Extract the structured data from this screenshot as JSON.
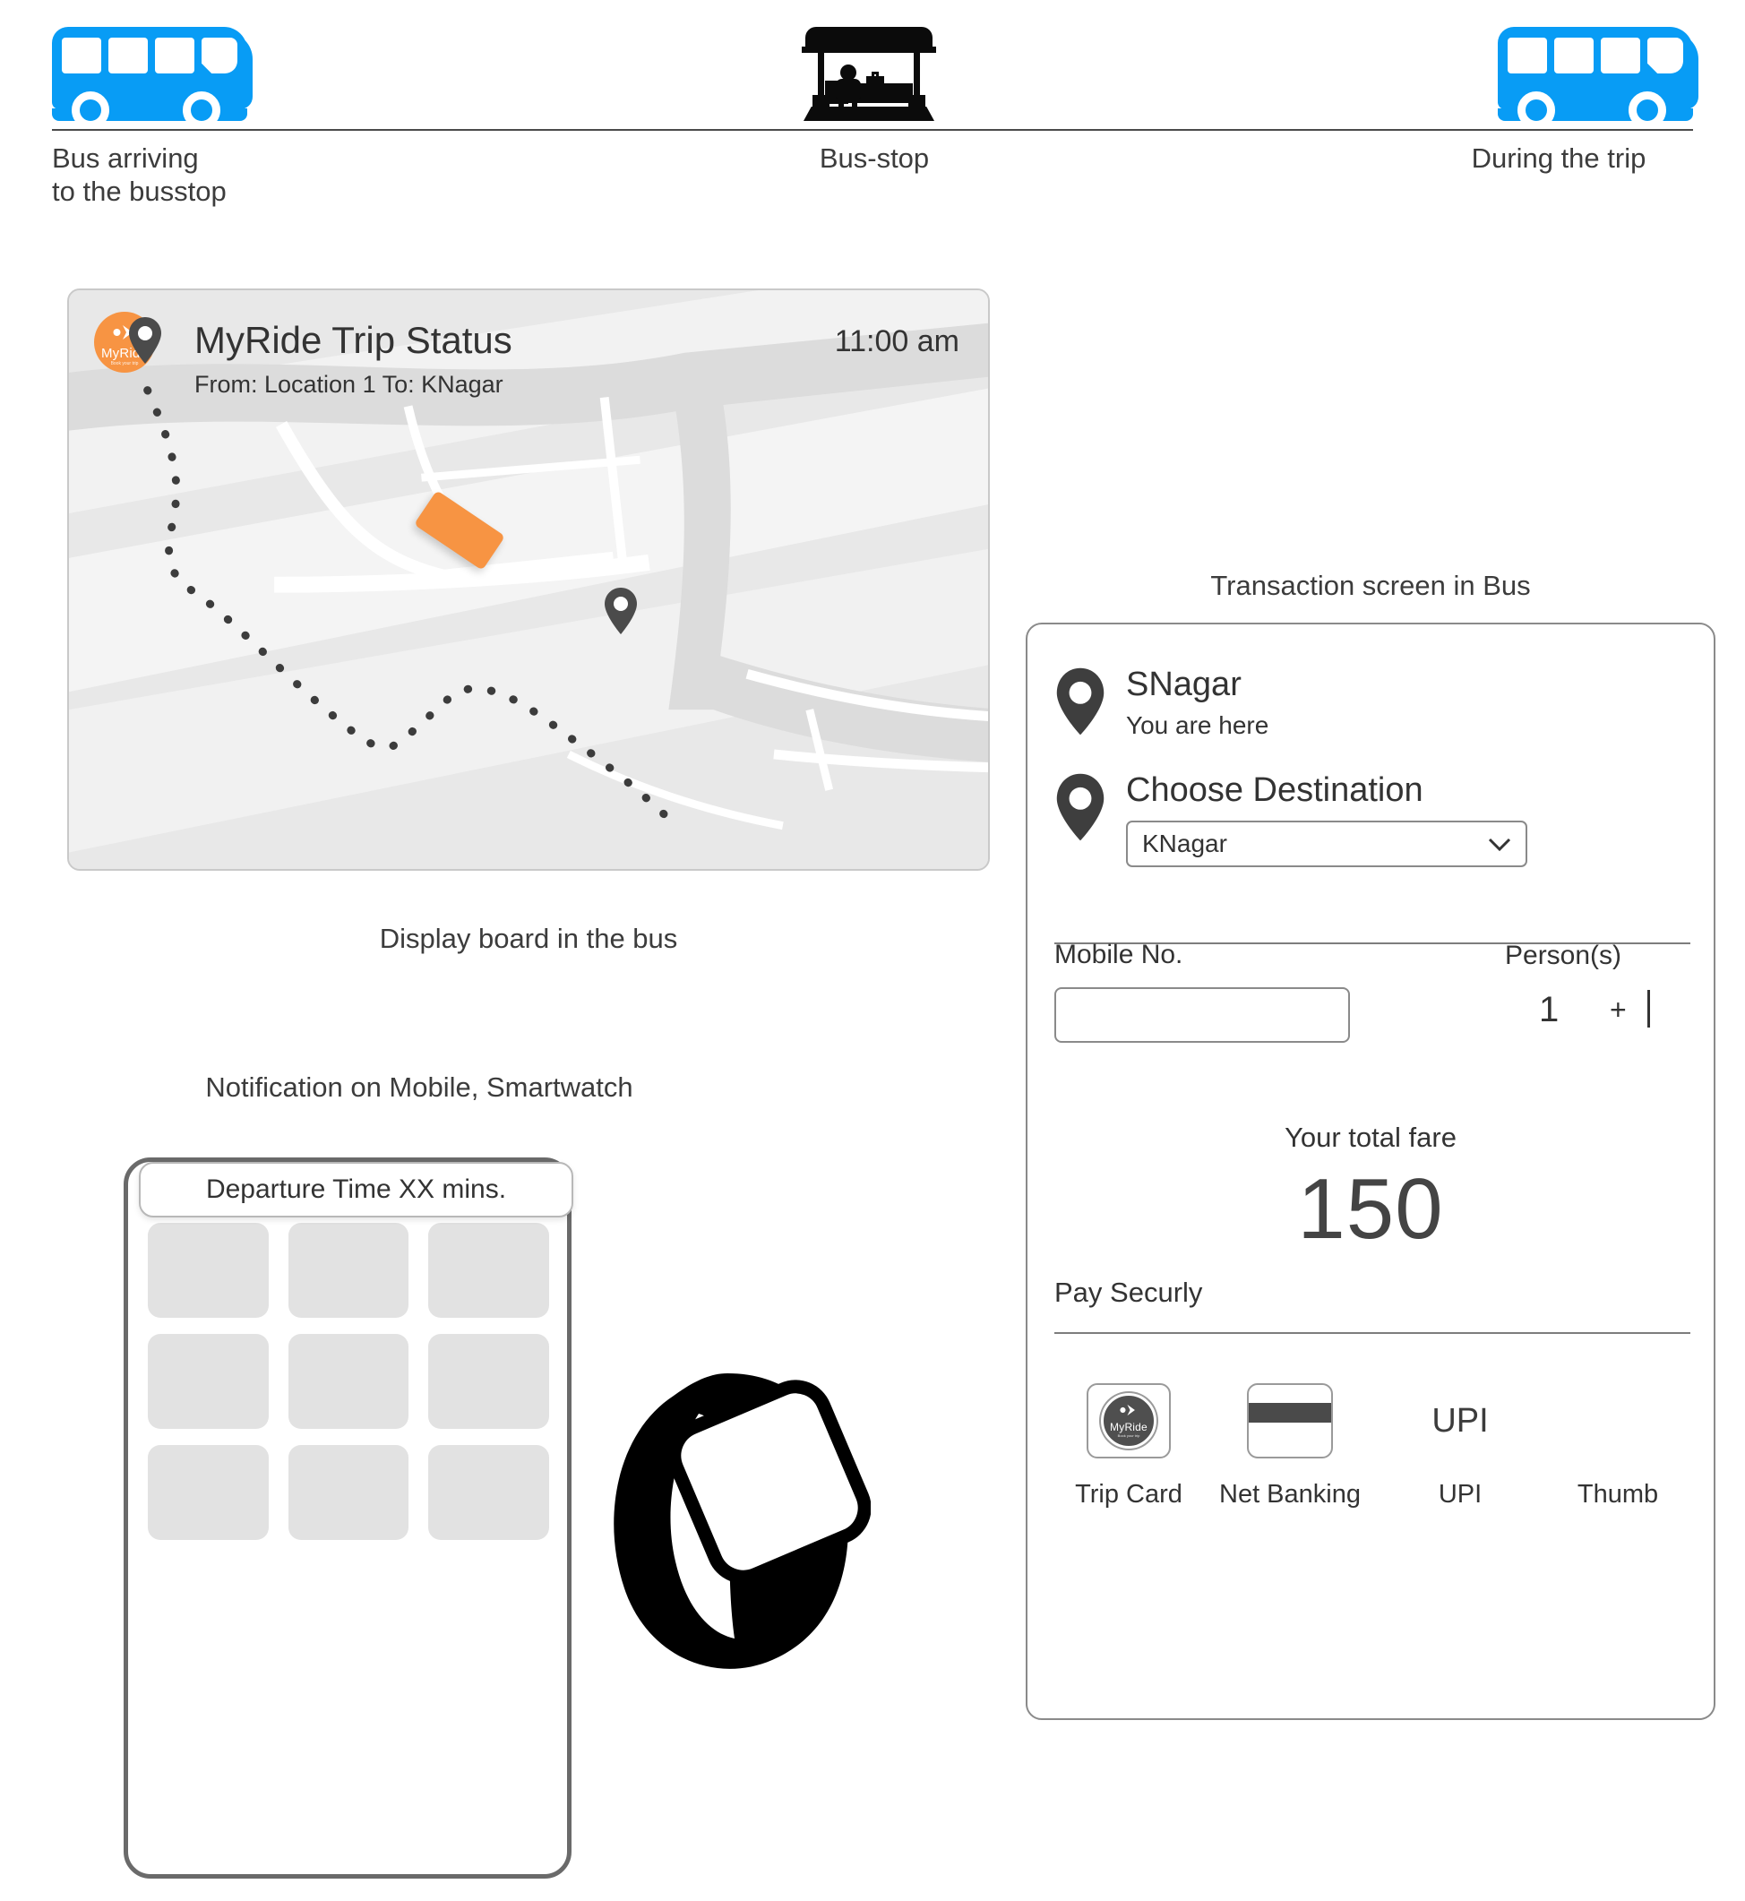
{
  "journey_strip": {
    "stages": [
      {
        "icon": "bus-icon",
        "caption": "Bus arriving\nto the busstop"
      },
      {
        "icon": "bus-stop-shelter-icon",
        "caption": "Bus-stop"
      },
      {
        "icon": "bus-icon",
        "caption": "During the trip"
      }
    ]
  },
  "display_board": {
    "caption": "Display board in the bus",
    "logo": {
      "name": "MyRide",
      "tagline": "Book your trip",
      "icon": "chevron-right-icon",
      "color": "#f79443"
    },
    "title": "MyRide Trip Status",
    "time": "11:00 am",
    "route": "From: Location 1 To: KNagar",
    "origin_pin": "map-pin-icon",
    "destination_pin": "map-pin-icon",
    "vehicle_marker": "bus-marker"
  },
  "notification": {
    "caption": "Notification on Mobile, Smartwatch",
    "banner_text": "Departure Time XX mins.",
    "app_tiles": [
      "",
      "",
      "",
      "",
      "",
      "",
      "",
      "",
      ""
    ],
    "watch_icon": "smartwatch-icon"
  },
  "transaction": {
    "caption": "Transaction screen in Bus",
    "current_location": {
      "pin": "map-pin-icon",
      "name": "SNagar",
      "subtitle": "You are here"
    },
    "destination": {
      "pin": "map-pin-icon",
      "label": "Choose Destination",
      "selected": "KNagar",
      "chevron": "chevron-down-icon",
      "options": [
        "KNagar"
      ]
    },
    "mobile": {
      "label": "Mobile No.",
      "value": "",
      "placeholder": ""
    },
    "persons": {
      "label": "Person(s)",
      "count": "1",
      "plus": "+",
      "cursor": "|"
    },
    "fare": {
      "label": "Your total fare",
      "amount": "150"
    },
    "pay": {
      "label": "Pay Securly",
      "methods": [
        {
          "icon": "myride-trip-card-icon",
          "label": "Trip Card",
          "glyph": ""
        },
        {
          "icon": "credit-card-icon",
          "label": "Net Banking",
          "glyph": ""
        },
        {
          "icon": "upi-text-icon",
          "label": "UPI",
          "glyph": "UPI"
        },
        {
          "icon": "thumbprint-icon",
          "label": "Thumb",
          "glyph": ""
        }
      ]
    }
  }
}
